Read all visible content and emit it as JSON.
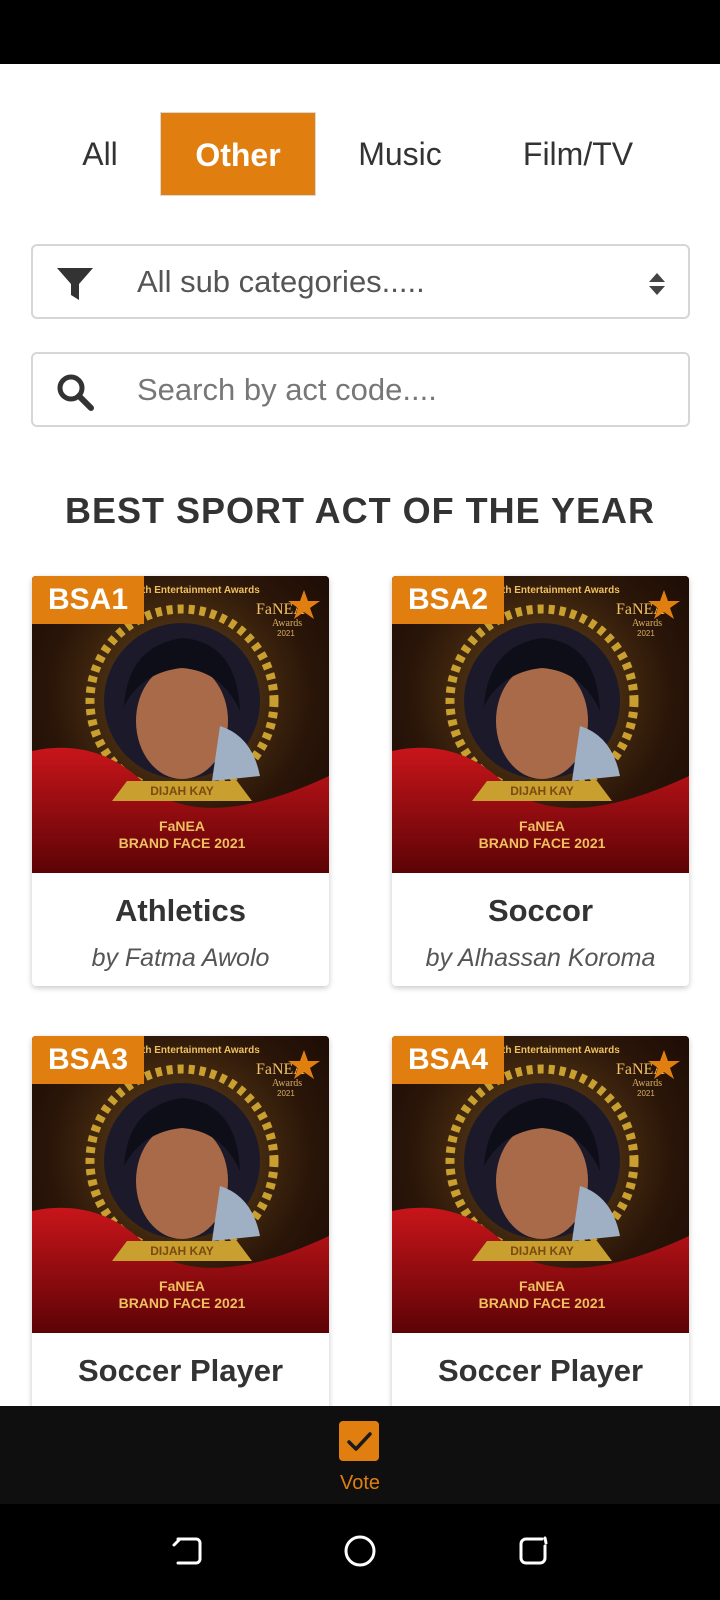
{
  "tabs": [
    {
      "label": "All",
      "active": false
    },
    {
      "label": "Other",
      "active": true
    },
    {
      "label": "Music",
      "active": false
    },
    {
      "label": "Film/TV",
      "active": false
    }
  ],
  "filter": {
    "selected": "All sub categories.....",
    "icon": "filter-icon"
  },
  "search": {
    "placeholder": "Search by act code....",
    "value": "",
    "icon": "search-icon"
  },
  "section": {
    "title": "BEST SPORT ACT OF THE YEAR"
  },
  "poster_text": {
    "header": "th Entertainment Awards",
    "brand": "FaNEA",
    "brand_sub": "Awards",
    "brand_year": "2021",
    "ribbon": "DIJAH KAY",
    "footer_line1": "FaNEA",
    "footer_line2": "BRAND FACE 2021"
  },
  "acts": [
    {
      "code": "BSA1",
      "name": "Athletics",
      "by": "by Fatma Awolo"
    },
    {
      "code": "BSA2",
      "name": "Soccor",
      "by": "by Alhassan Koroma"
    },
    {
      "code": "BSA3",
      "name": "Soccer Player",
      "by": ""
    },
    {
      "code": "BSA4",
      "name": "Soccer Player",
      "by": ""
    }
  ],
  "bottom_nav": {
    "vote_label": "Vote",
    "vote_icon": "checkbox-check-icon"
  },
  "colors": {
    "accent": "#e07f10",
    "status_bar": "#000000",
    "nav_bg": "#0f0f0f"
  }
}
